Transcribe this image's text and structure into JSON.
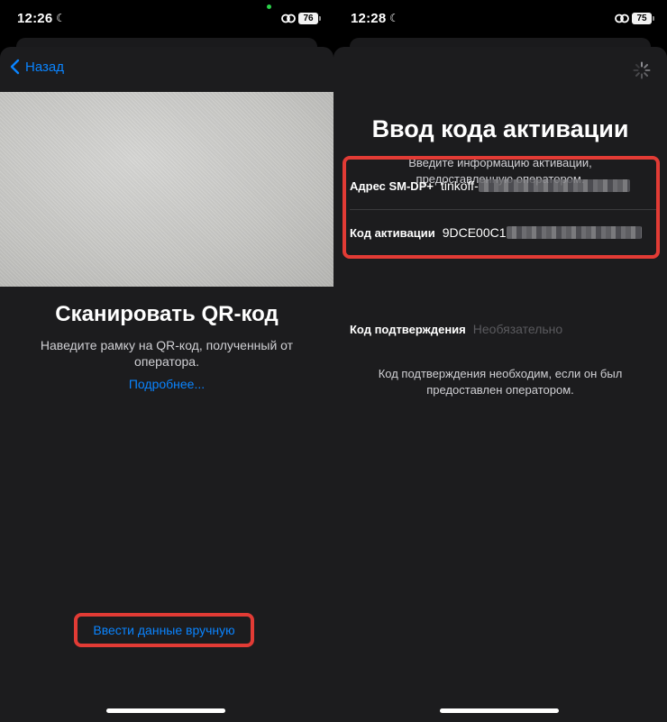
{
  "left_screen": {
    "status": {
      "time": "12:26",
      "battery": "76"
    },
    "back_label": "Назад",
    "title": "Сканировать QR-код",
    "subtitle": "Наведите рамку на QR-код, полученный от оператора.",
    "more_link": "Подробнее...",
    "manual_button": "Ввести данные вручную"
  },
  "right_screen": {
    "status": {
      "time": "12:28",
      "battery": "75"
    },
    "title": "Ввод кода активации",
    "subtitle": "Введите информацию активации, предоставленную оператором.",
    "fields": [
      {
        "label": "Адрес SM-DP+",
        "value": "tinkoff-"
      },
      {
        "label": "Код активации",
        "value": "9DCE00C1"
      }
    ],
    "confirmation": {
      "label": "Код подтверждения",
      "placeholder": "Необязательно"
    },
    "note": "Код подтверждения необходим, если он был предоставлен оператором."
  },
  "colors": {
    "accent": "#0a84ff",
    "highlight": "#e23b35",
    "sheet": "#1c1c1e"
  }
}
